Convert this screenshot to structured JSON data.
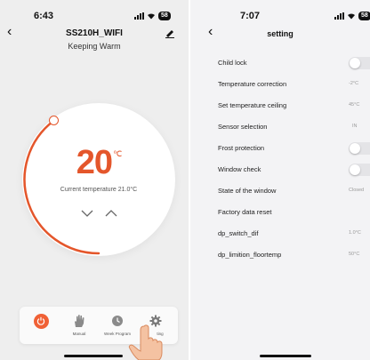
{
  "colors": {
    "accent": "#e4562b",
    "power_button": "#f06136",
    "toggle_off": "#e4e4e7"
  },
  "thermostat_screen": {
    "status_bar": {
      "time": "6:43",
      "battery": "58"
    },
    "title": "SS210H_WIFI",
    "subtitle": "Keeping Warm",
    "setpoint": "20",
    "unit": "℃",
    "current_temperature": "Current temperature 21.0°C",
    "tabs": [
      {
        "label": "",
        "icon": "power-icon"
      },
      {
        "label": "Manual",
        "icon": "hand-icon"
      },
      {
        "label": "Week Program",
        "icon": "clock-icon"
      },
      {
        "label": "ting",
        "icon": "gear-icon"
      }
    ]
  },
  "settings_screen": {
    "status_bar": {
      "time": "7:07",
      "battery": "58"
    },
    "title": "setting",
    "rows": [
      {
        "label": "Child lock",
        "type": "toggle",
        "on": false
      },
      {
        "label": "Temperature correction",
        "value": "-2°C"
      },
      {
        "label": "Set temperature ceiling",
        "value": "45°C"
      },
      {
        "label": "Sensor selection",
        "value": "IN"
      },
      {
        "label": "Frost protection",
        "type": "toggle",
        "on": false
      },
      {
        "label": "Window check",
        "type": "toggle",
        "on": false
      },
      {
        "label": "State of the window",
        "value": "Closed"
      },
      {
        "label": "Factory data reset"
      },
      {
        "label": "dp_switch_dif",
        "value": "1.0°C"
      },
      {
        "label": "dp_limition_floortemp",
        "value": "50°C"
      }
    ]
  }
}
